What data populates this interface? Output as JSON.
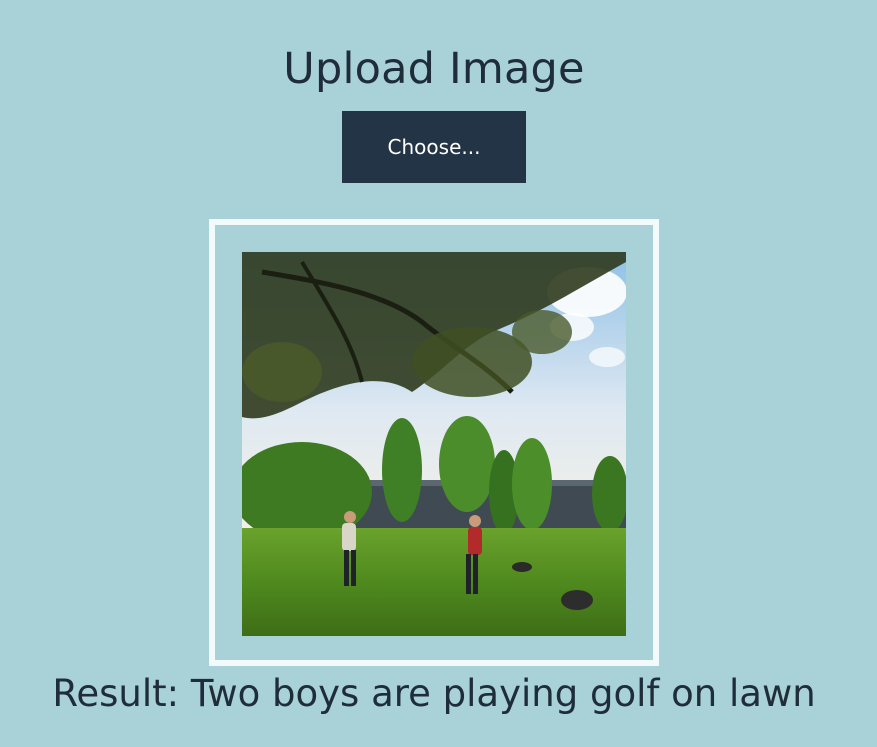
{
  "page": {
    "title": "Upload Image",
    "choose_button_label": "Choose...",
    "result_label": "Result:",
    "result_text": "Two boys are playing golf on lawn"
  },
  "image": {
    "content": "photo-two-boys-on-lawn"
  },
  "colors": {
    "background": "#a8d1d8",
    "button": "#243447",
    "text": "#1f2d3b",
    "frame": "#f3fafb"
  }
}
